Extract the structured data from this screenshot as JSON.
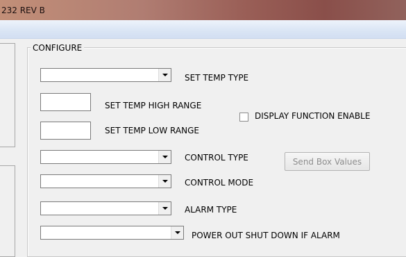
{
  "window": {
    "title": "232 REV B"
  },
  "configure": {
    "legend": "CONFIGURE",
    "set_temp_type": {
      "label": "SET TEMP TYPE",
      "value": ""
    },
    "set_temp_high_range": {
      "label": "SET TEMP HIGH RANGE",
      "value": ""
    },
    "set_temp_low_range": {
      "label": "SET TEMP LOW RANGE",
      "value": ""
    },
    "display_function_enable": {
      "label": "DISPLAY FUNCTION ENABLE",
      "checked": false
    },
    "control_type": {
      "label": "CONTROL TYPE",
      "value": ""
    },
    "control_mode": {
      "label": "CONTROL MODE",
      "value": ""
    },
    "alarm_type": {
      "label": "ALARM TYPE",
      "value": ""
    },
    "power_out_shutdown": {
      "label": "POWER OUT SHUT DOWN IF ALARM",
      "value": ""
    },
    "send_box_values_label": "Send Box Values"
  },
  "icons": {
    "dropdown": "chevron-down-icon"
  }
}
